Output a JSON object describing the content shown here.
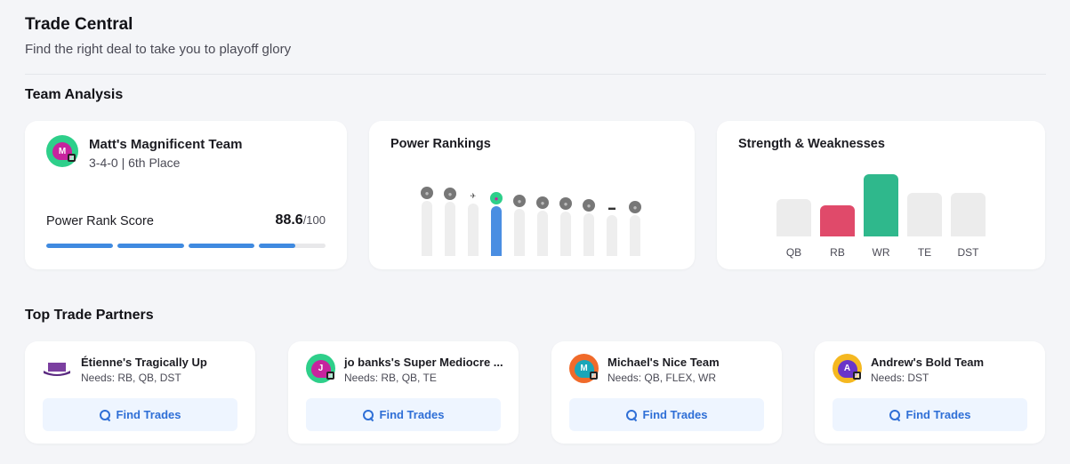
{
  "header": {
    "title": "Trade Central",
    "subtitle": "Find the right deal to take you to playoff glory"
  },
  "sections": {
    "team_analysis": "Team Analysis",
    "top_partners": "Top Trade Partners"
  },
  "team": {
    "name": "Matt's Magnificent Team",
    "record": "3-4-0 | 6th Place",
    "avatar_letter": "M",
    "avatar_bg": "#2ecf8a",
    "helmet_color": "#c7249e",
    "power_rank_label": "Power Rank Score",
    "power_rank_score": "88.6",
    "power_rank_max": "/100",
    "power_rank_value": 0.886
  },
  "power_rankings": {
    "title": "Power Rankings",
    "highlight_color": "#4a8ee2",
    "teams": [
      {
        "level": 0.78,
        "icon": "helmet-icon",
        "mine": false
      },
      {
        "level": 0.76,
        "icon": "helmet-icon",
        "mine": false
      },
      {
        "level": 0.74,
        "icon": "mascot-icon",
        "mine": false
      },
      {
        "level": 0.7,
        "icon": "helmet-icon",
        "mine": true
      },
      {
        "level": 0.66,
        "icon": "helmet-icon",
        "mine": false
      },
      {
        "level": 0.64,
        "icon": "helmet-icon",
        "mine": false
      },
      {
        "level": 0.62,
        "icon": "helmet-icon",
        "mine": false
      },
      {
        "level": 0.6,
        "icon": "helmet-icon",
        "mine": false
      },
      {
        "level": 0.58,
        "icon": "hat-icon",
        "mine": false
      },
      {
        "level": 0.58,
        "icon": "helmet-icon",
        "mine": false
      }
    ]
  },
  "strengths": {
    "title": "Strength & Weaknesses",
    "positions": [
      {
        "label": "QB",
        "level": 0.6,
        "color": "#ececec"
      },
      {
        "label": "RB",
        "level": 0.5,
        "color": "#e04a6a"
      },
      {
        "label": "WR",
        "level": 1.0,
        "color": "#2fb88c"
      },
      {
        "label": "TE",
        "level": 0.7,
        "color": "#ececec"
      },
      {
        "label": "DST",
        "level": 0.7,
        "color": "#ececec"
      }
    ]
  },
  "partners": [
    {
      "name": "Étienne's Tragically Up",
      "needs": "Needs: RB, QB, DST",
      "avatar": "hat-icon",
      "avatar_bg": "#7b3fa0",
      "letter": "",
      "button": "Find Trades"
    },
    {
      "name": "jo banks's Super Mediocre ...",
      "needs": "Needs: RB, QB, TE",
      "avatar": "helmet-icon",
      "avatar_bg": "#2ecf8a",
      "helmet_color": "#c7249e",
      "letter": "J",
      "button": "Find Trades"
    },
    {
      "name": "Michael's Nice Team",
      "needs": "Needs: QB, FLEX, WR",
      "avatar": "helmet-icon",
      "avatar_bg": "#f06a2a",
      "helmet_color": "#1aa6b8",
      "letter": "M",
      "button": "Find Trades"
    },
    {
      "name": "Andrew's Bold Team",
      "needs": "Needs: DST",
      "avatar": "helmet-icon",
      "avatar_bg": "#f5b820",
      "helmet_color": "#6a35c9",
      "letter": "A",
      "button": "Find Trades"
    }
  ]
}
